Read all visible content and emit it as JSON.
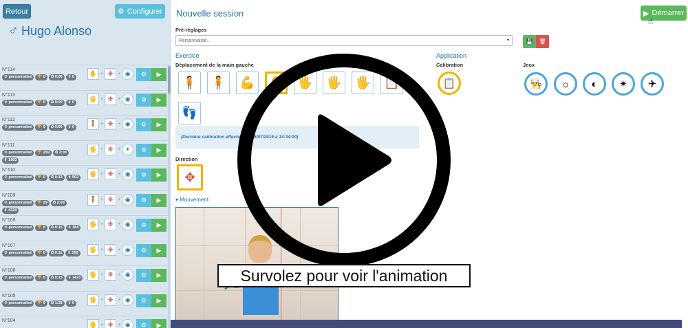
{
  "sidebar": {
    "back_label": "Retour",
    "configure_label": "Configurer",
    "patient_symbol": "♂",
    "patient_name": "Hugo  Alonso",
    "sessions": [
      {
        "num": "N°114",
        "tag1": "personnalisé",
        "tag2": "0",
        "tag3": "0:00",
        "tag4": "0"
      },
      {
        "num": "N°113",
        "tag1": "personnalisé",
        "tag2": "0",
        "tag3": "0:00",
        "tag4": "0"
      },
      {
        "num": "N°112",
        "tag1": "personnalisé",
        "tag2": "0",
        "tag3": "0:00",
        "tag4": "0"
      },
      {
        "num": "N°111",
        "tag1": "personnalisé",
        "tag2": "259",
        "tag3": "2:00",
        "tag4": "1993"
      },
      {
        "num": "N°110",
        "tag1": "personnalisé",
        "tag2": "0",
        "tag3": "0:13",
        "tag4": "502"
      },
      {
        "num": "N°109",
        "tag1": "personnalisé",
        "tag2": "29",
        "tag3": "2:00",
        "tag4": "4320"
      },
      {
        "num": "N°108",
        "tag1": "personnalisé",
        "tag2": "0",
        "tag3": "0:16",
        "tag4": "184"
      },
      {
        "num": "N°107",
        "tag1": "personnalisé",
        "tag2": "0",
        "tag3": "0:11",
        "tag4": "252"
      },
      {
        "num": "N°106",
        "tag1": "personnalisé",
        "tag2": "0",
        "tag3": "0:15",
        "tag4": "1423"
      },
      {
        "num": "N°105",
        "tag1": "personnalisé",
        "tag2": "0",
        "tag3": "1:28",
        "tag4": "0"
      },
      {
        "num": "N°104",
        "tag1": "",
        "tag2": "",
        "tag3": "",
        "tag4": ""
      }
    ]
  },
  "main": {
    "title": "Nouvelle session",
    "start_label": "Démarrer",
    "presets_label": "Pré-réglages",
    "presets_value": "Personnalisé...",
    "exercise_heading": "Exercice",
    "exercise_sub": "Déplacement de la main gauche",
    "application_heading": "Application",
    "calibration_label": "Calibration",
    "games_label": "Jeux",
    "calibration_note": "(Dernière calibration effectuée le 25/07/2016 à 14:34:00)",
    "direction_label": "Direction",
    "movement_label": "Mouvement"
  },
  "overlay": {
    "hover_text": "Survolez pour voir l'animation"
  },
  "colors": {
    "accent": "#2a72a8",
    "success": "#5cb85c",
    "info": "#5bc0de",
    "danger": "#d9534f",
    "selected": "#f0b400"
  }
}
